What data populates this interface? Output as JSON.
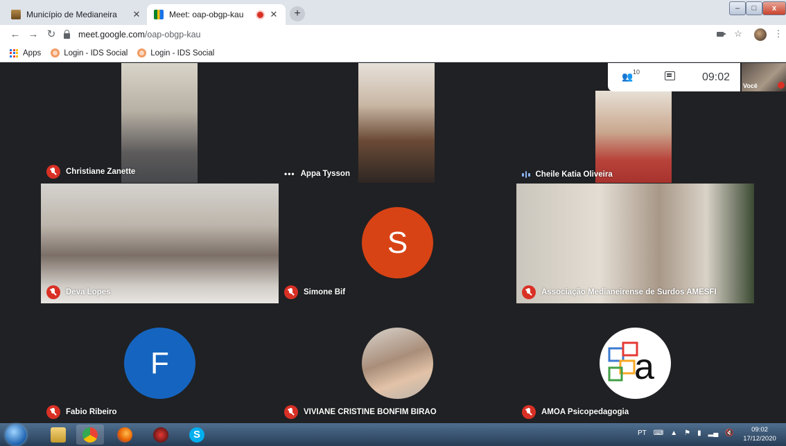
{
  "browser": {
    "tabs": [
      {
        "title": "Município de Medianeira",
        "active": false
      },
      {
        "title": "Meet: oap-obgp-kau",
        "active": true
      }
    ],
    "new_tab": "+",
    "window_controls": {
      "minimize": "–",
      "maximize": "□",
      "close": "x"
    },
    "url_domain": "meet.google.com",
    "url_path": "/oap-obgp-kau",
    "bookmarks": [
      {
        "label": "Apps",
        "icon": "apps-grid-icon"
      },
      {
        "label": "Login - IDS Social",
        "icon": "ids-social-icon"
      },
      {
        "label": "Login - IDS Social",
        "icon": "ids-social-icon"
      }
    ]
  },
  "meet": {
    "participant_count": "10",
    "time": "09:02",
    "self_label": "Você",
    "participants": [
      {
        "name": "Christiane Zanette",
        "status": "muted"
      },
      {
        "name": "Appa Tysson",
        "status": "connecting"
      },
      {
        "name": "Cheile Katia Oliveira",
        "status": "speaking"
      },
      {
        "name": "Deva Lopes",
        "status": "muted"
      },
      {
        "name": "Simone Bif",
        "status": "muted",
        "initial": "S",
        "avatar_color": "#d84315"
      },
      {
        "name": "Associação Medianeirense de Surdos AMESFI",
        "status": "muted"
      },
      {
        "name": "Fabio Ribeiro",
        "status": "muted",
        "initial": "F",
        "avatar_color": "#1565c0"
      },
      {
        "name": "VIVIANE CRISTINE BONFIM BIRAO",
        "status": "muted"
      },
      {
        "name": "AMOA Psicopedagogia",
        "status": "muted"
      }
    ]
  },
  "taskbar": {
    "language": "PT",
    "clock_time": "09:02",
    "clock_date": "17/12/2020"
  },
  "colors": {
    "meet_bg": "#202124",
    "muted_red": "#d93025",
    "speaking_blue": "#8ab4f8"
  }
}
